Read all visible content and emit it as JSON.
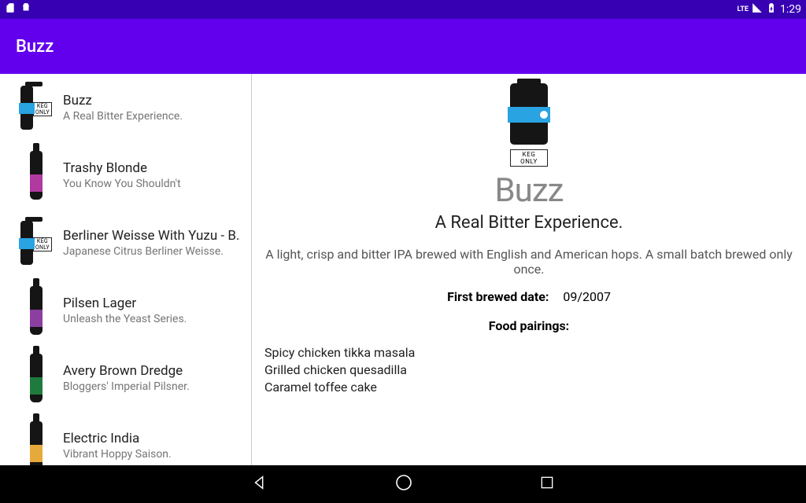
{
  "status": {
    "time": "1:29",
    "net": "LTE"
  },
  "appbar": {
    "title": "Buzz"
  },
  "list": [
    {
      "title": "Buzz",
      "tag": "A Real Bitter Experience.",
      "thumb": "can",
      "label_color": "#29a3e2",
      "keg_only": "KEG ONLY"
    },
    {
      "title": "Trashy Blonde",
      "tag": "You Know You Shouldn't",
      "thumb": "bottle",
      "label_color": "#b03aa0"
    },
    {
      "title": "Berliner Weisse With Yuzu - B…",
      "tag": "Japanese Citrus Berliner Weisse.",
      "thumb": "can",
      "label_color": "#29a3e2",
      "keg_only": "KEG ONLY"
    },
    {
      "title": "Pilsen Lager",
      "tag": "Unleash the Yeast Series.",
      "thumb": "bottle",
      "label_color": "#8b3fa0"
    },
    {
      "title": "Avery Brown Dredge",
      "tag": "Bloggers' Imperial Pilsner.",
      "thumb": "bottle",
      "label_color": "#1f7a3e"
    },
    {
      "title": "Electric India",
      "tag": "Vibrant Hoppy Saison.",
      "thumb": "bottle",
      "label_color": "#e6a93c"
    }
  ],
  "detail": {
    "title": "Buzz",
    "tag": "A Real Bitter Experience.",
    "desc": "A light, crisp and bitter IPA brewed with English and American hops. A small batch brewed only once.",
    "first_brewed_label": "First brewed date:",
    "first_brewed": "09/2007",
    "pairings_label": "Food pairings:",
    "pairings": [
      "Spicy chicken tikka masala",
      "Grilled chicken quesadilla",
      "Caramel toffee cake"
    ],
    "keg_only": "KEG ONLY"
  }
}
